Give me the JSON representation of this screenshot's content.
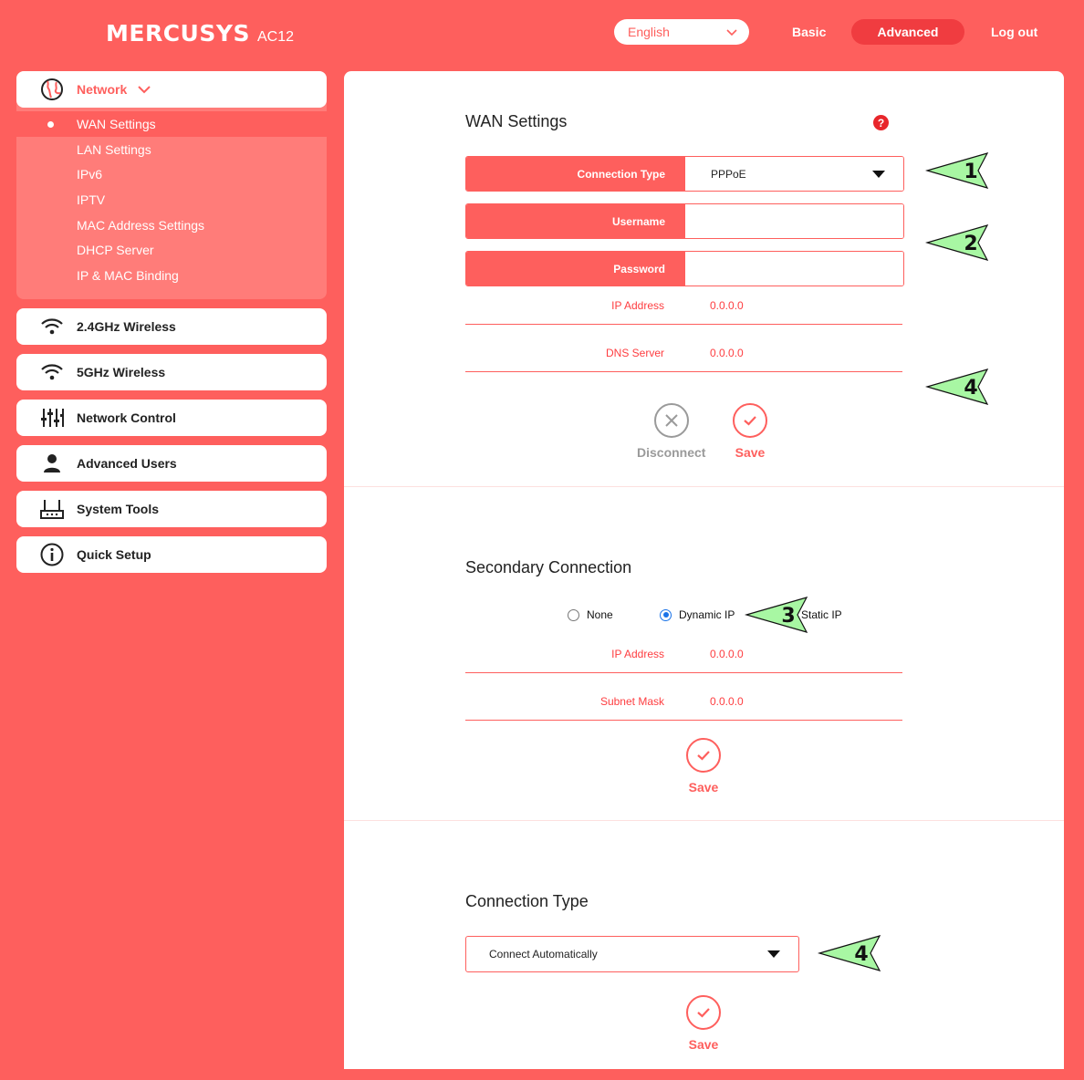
{
  "header": {
    "brand": "MERCUSYS",
    "model": "AC12",
    "language": "English",
    "nav_basic": "Basic",
    "nav_advanced": "Advanced",
    "nav_logout": "Log out"
  },
  "sidebar": {
    "network": {
      "label": "Network",
      "icon": "globe-icon",
      "subitems": [
        "WAN Settings",
        "LAN Settings",
        "IPv6",
        "IPTV",
        "MAC Address Settings",
        "DHCP Server",
        "IP & MAC Binding"
      ]
    },
    "items": [
      {
        "label": "2.4GHz Wireless",
        "icon": "wifi-icon"
      },
      {
        "label": "5GHz Wireless",
        "icon": "wifi-icon"
      },
      {
        "label": "Network Control",
        "icon": "sliders-icon"
      },
      {
        "label": "Advanced Users",
        "icon": "user-icon"
      },
      {
        "label": "System Tools",
        "icon": "router-icon"
      },
      {
        "label": "Quick Setup",
        "icon": "info-icon"
      }
    ]
  },
  "wan": {
    "title": "WAN Settings",
    "help": "?",
    "connection_type_label": "Connection Type",
    "connection_type_value": "PPPoE",
    "username_label": "Username",
    "username_value": "",
    "password_label": "Password",
    "password_value": "",
    "ip_label": "IP Address",
    "ip_value": "0.0.0.0",
    "dns_label": "DNS Server",
    "dns_value": "0.0.0.0",
    "disconnect_label": "Disconnect",
    "save_label": "Save"
  },
  "secondary": {
    "title": "Secondary Connection",
    "options": [
      "None",
      "Dynamic IP",
      "Static IP"
    ],
    "selected": "Dynamic IP",
    "ip_label": "IP Address",
    "ip_value": "0.0.0.0",
    "mask_label": "Subnet Mask",
    "mask_value": "0.0.0.0",
    "save_label": "Save"
  },
  "conn": {
    "title": "Connection Type",
    "value": "Connect Automatically",
    "save_label": "Save"
  },
  "annotations": [
    "1",
    "2",
    "3",
    "4",
    "4"
  ],
  "colors": {
    "accent": "#fe5f5d",
    "marker": "#a8f7a3"
  }
}
